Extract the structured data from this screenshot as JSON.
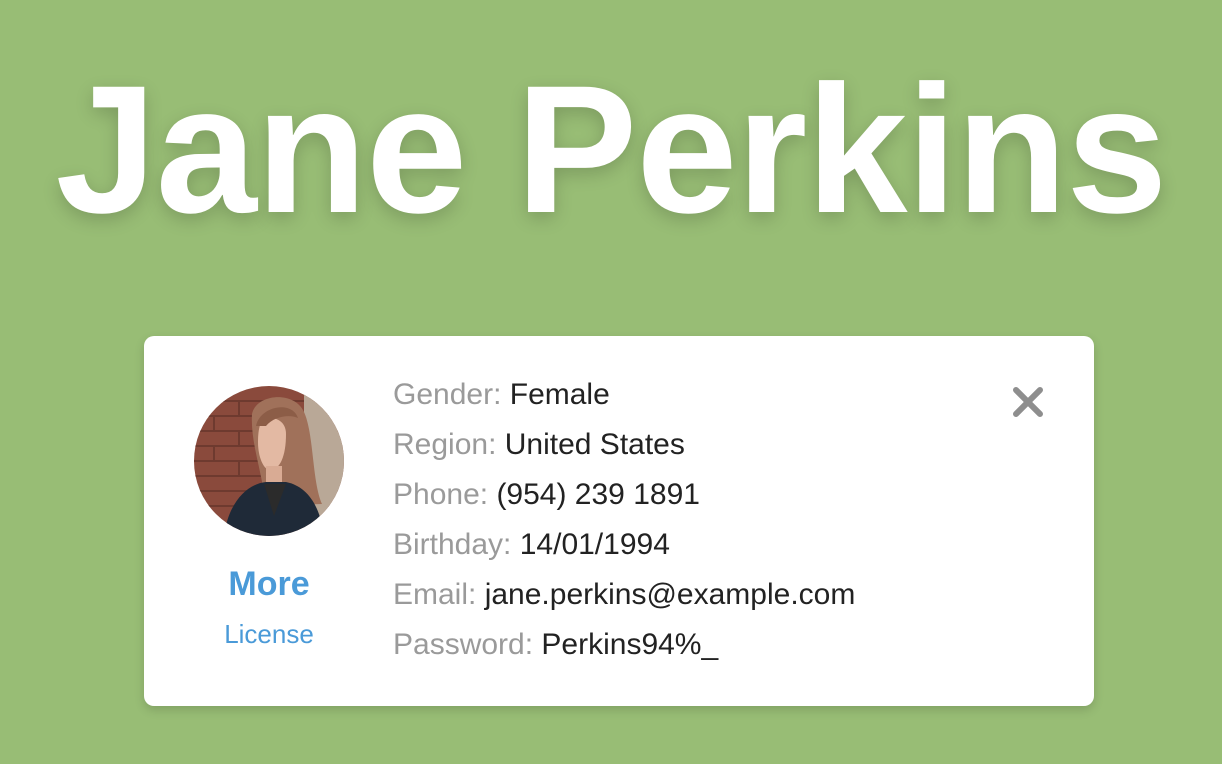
{
  "title": "Jane Perkins",
  "colors": {
    "background": "#98bd75",
    "card": "#ffffff",
    "link": "#4a9ad8",
    "label": "#9a9a9a",
    "value": "#222222",
    "close": "#8e8e8e"
  },
  "profile": {
    "avatar_icon": "profile-photo",
    "more_label": "More",
    "license_label": "License",
    "close_icon": "close-icon",
    "fields": [
      {
        "label": "Gender:",
        "value": "Female"
      },
      {
        "label": "Region:",
        "value": "United States"
      },
      {
        "label": "Phone:",
        "value": "(954) 239 1891"
      },
      {
        "label": "Birthday:",
        "value": "14/01/1994"
      },
      {
        "label": "Email:",
        "value": "jane.perkins@example.com"
      },
      {
        "label": "Password:",
        "value": "Perkins94%_"
      }
    ]
  }
}
